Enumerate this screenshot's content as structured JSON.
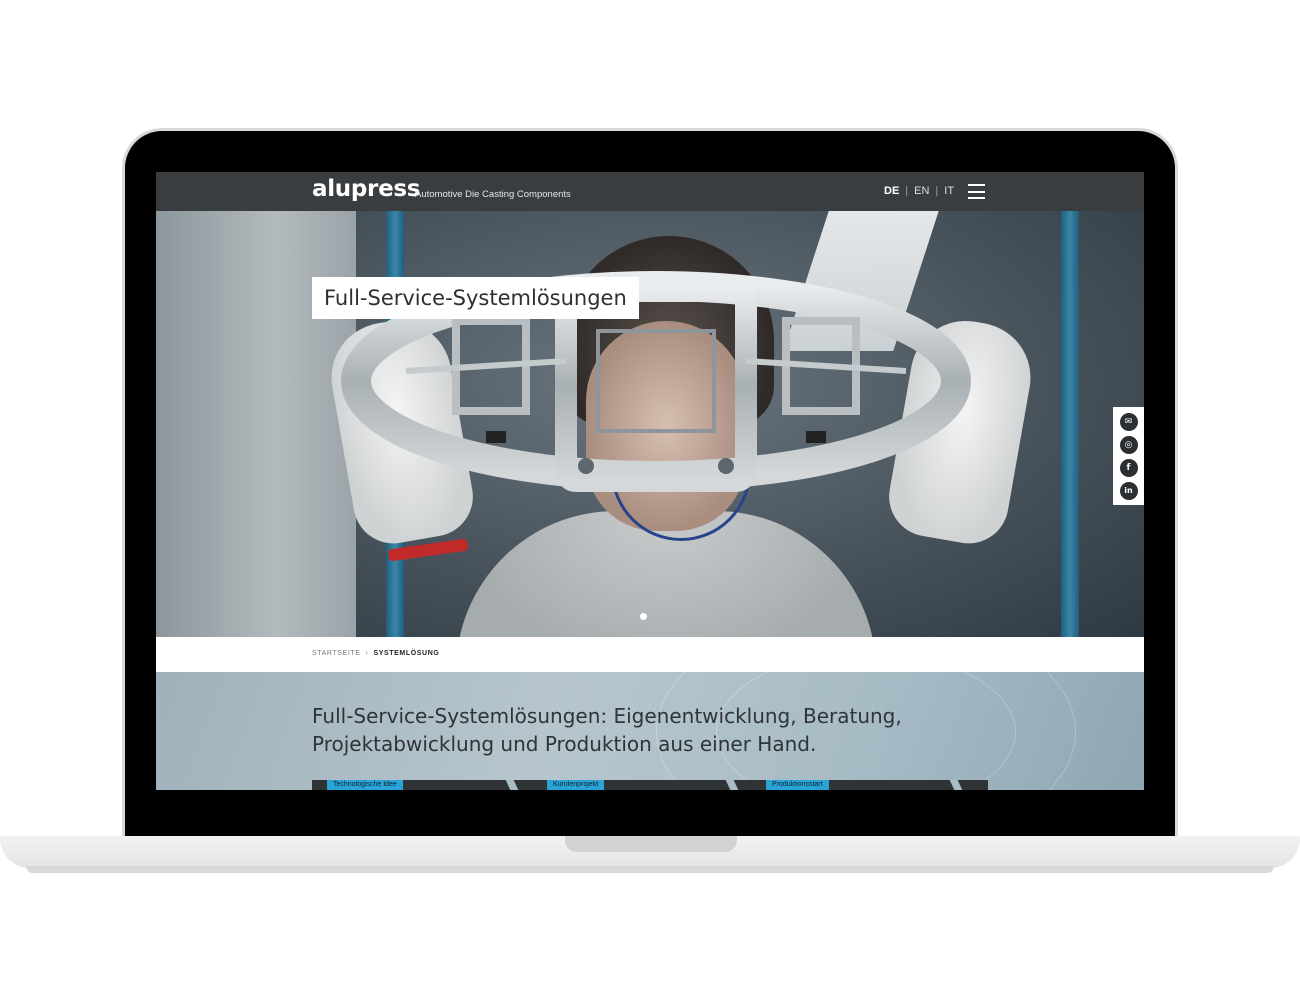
{
  "header": {
    "logo": "alupress",
    "tagline": "Automotive Die Casting Components",
    "languages": [
      {
        "label": "DE",
        "active": true
      },
      {
        "label": "EN",
        "active": false
      },
      {
        "label": "IT",
        "active": false
      }
    ],
    "menu_icon": "hamburger-icon"
  },
  "hero": {
    "title": "Full-Service-Systemlösungen"
  },
  "social": [
    {
      "icon": "mail-icon",
      "glyph": "✉"
    },
    {
      "icon": "instagram-icon",
      "glyph": "◎"
    },
    {
      "icon": "facebook-icon",
      "glyph": "f"
    },
    {
      "icon": "linkedin-icon",
      "glyph": "in"
    }
  ],
  "breadcrumb": {
    "home": "STARTSEITE",
    "separator": "›",
    "current": "SYSTEMLÖSUNG"
  },
  "intro": {
    "heading": "Full-Service-Systemlösungen: Eigenentwicklung, Beratung, Projektabwicklung und Produktion aus einer Hand."
  },
  "timeline": {
    "steps": [
      "Technologische Idee",
      "Kundenprojekt",
      "Produktionsstart"
    ]
  },
  "colors": {
    "header_bg": "#3a3d40",
    "accent": "#2aa3d6",
    "text_dark": "#2f3438"
  }
}
